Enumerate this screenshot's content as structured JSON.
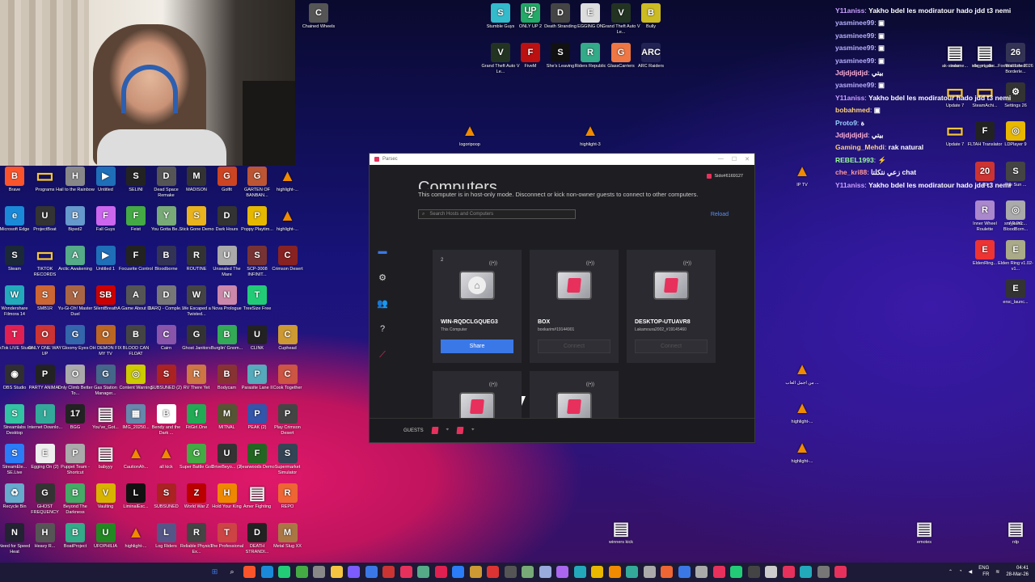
{
  "left_icons": [
    {
      "label": "Brave",
      "color": "#fb542b",
      "glyph": "B"
    },
    {
      "label": "Programs",
      "color": "#f5c542",
      "glyph": "▭"
    },
    {
      "label": "Hail to the Rainbow",
      "color": "#888",
      "glyph": "H"
    },
    {
      "label": "Untitled",
      "color": "#1e6fb8",
      "glyph": "▶"
    },
    {
      "label": "SELINI",
      "color": "#222",
      "glyph": "S"
    },
    {
      "label": "Dead Space Remake",
      "color": "#555",
      "glyph": "D"
    },
    {
      "label": "MADISON",
      "color": "#333",
      "glyph": "M"
    },
    {
      "label": "Golfit",
      "color": "#c42",
      "glyph": "G"
    },
    {
      "label": "GARTEN OF BANBAN...",
      "color": "#b53",
      "glyph": "G"
    },
    {
      "label": "highlight-...",
      "color": "#f08a00",
      "glyph": "▲"
    },
    {
      "label": "Microsoft Edge",
      "color": "#1a8ad8",
      "glyph": "e"
    },
    {
      "label": "ProjectBoat",
      "color": "#333",
      "glyph": "U"
    },
    {
      "label": "Biped2",
      "color": "#69c",
      "glyph": "B"
    },
    {
      "label": "Fall Guys",
      "color": "#c6e",
      "glyph": "F"
    },
    {
      "label": "Feist",
      "color": "#4a4",
      "glyph": "F"
    },
    {
      "label": "You Gotta Be...",
      "color": "#7a7",
      "glyph": "Y"
    },
    {
      "label": "Stick Gone Demo",
      "color": "#e8b31d",
      "glyph": "S"
    },
    {
      "label": "Dark Hours",
      "color": "#333",
      "glyph": "D"
    },
    {
      "label": "Poppy Playtim...",
      "color": "#e6b800",
      "glyph": "P"
    },
    {
      "label": "highlight-...",
      "color": "#f08a00",
      "glyph": "▲"
    },
    {
      "label": "Steam",
      "color": "#1b2838",
      "glyph": "S"
    },
    {
      "label": "TIKTOK RECORDS",
      "color": "#f5c542",
      "glyph": "▭"
    },
    {
      "label": "Arctic Awakening",
      "color": "#5a8",
      "glyph": "A"
    },
    {
      "label": "Untitled 1",
      "color": "#1e6fb8",
      "glyph": "▶"
    },
    {
      "label": "Focusrite Control",
      "color": "#222",
      "glyph": "F"
    },
    {
      "label": "Bloodborne",
      "color": "#335",
      "glyph": "B"
    },
    {
      "label": "ROUTINE",
      "color": "#333",
      "glyph": "R"
    },
    {
      "label": "Unsealed The Mare",
      "color": "#aaa",
      "glyph": "U"
    },
    {
      "label": "SCP-3008 INFINIT...",
      "color": "#733",
      "glyph": "S"
    },
    {
      "label": "Crimson Desert",
      "color": "#822",
      "glyph": "C"
    },
    {
      "label": "Wondershare Filmora 14",
      "color": "#2ab",
      "glyph": "W"
    },
    {
      "label": "SMB1R",
      "color": "#c63",
      "glyph": "S"
    },
    {
      "label": "Yu-Gi-Oh! Master Duel",
      "color": "#a64",
      "glyph": "Y"
    },
    {
      "label": "SilentBreath",
      "color": "#c00",
      "glyph": "SB"
    },
    {
      "label": "A Game About D...",
      "color": "#555",
      "glyph": "A"
    },
    {
      "label": "DARQ - Comple...",
      "color": "#777",
      "glyph": "D"
    },
    {
      "label": "We Escaped a Twisted...",
      "color": "#444",
      "glyph": "W"
    },
    {
      "label": "Nova Prologue",
      "color": "#c8a",
      "glyph": "N"
    },
    {
      "label": "TreeSize Free",
      "color": "#2c7",
      "glyph": "T"
    },
    {
      "label": "",
      "color": "transparent",
      "glyph": ""
    },
    {
      "label": "TikTok LIVE Studio",
      "color": "#e02050",
      "glyph": "T"
    },
    {
      "label": "ONLY ONE WAY UP",
      "color": "#c33",
      "glyph": "O"
    },
    {
      "label": "Gloomy Eyes",
      "color": "#36a",
      "glyph": "G"
    },
    {
      "label": "OH DEMON FIX MY TV",
      "color": "#b62",
      "glyph": "O"
    },
    {
      "label": "BLOOD CAN FLOAT",
      "color": "#444",
      "glyph": "B"
    },
    {
      "label": "Cairn",
      "color": "#85a",
      "glyph": "C"
    },
    {
      "label": "Ghost Janitors",
      "color": "#333",
      "glyph": "G"
    },
    {
      "label": "Burglin' Gnom...",
      "color": "#3a5",
      "glyph": "B"
    },
    {
      "label": "CLINK",
      "color": "#222",
      "glyph": "U"
    },
    {
      "label": "Cuphead",
      "color": "#c93",
      "glyph": "C"
    },
    {
      "label": "OBS Studio",
      "color": "#302e31",
      "glyph": "◉"
    },
    {
      "label": "PARTY ANIMAL",
      "color": "#222",
      "glyph": "P"
    },
    {
      "label": "Only Climb Better To...",
      "color": "#aaa",
      "glyph": "O"
    },
    {
      "label": "Gas Station Manager...",
      "color": "#468",
      "glyph": "G"
    },
    {
      "label": "Content Warning",
      "color": "#cc0",
      "glyph": "◎"
    },
    {
      "label": "SUBSUNED (2)",
      "color": "#a22",
      "glyph": "S"
    },
    {
      "label": "RV There Yet",
      "color": "#c74",
      "glyph": "R"
    },
    {
      "label": "Bodycam",
      "color": "#833",
      "glyph": "B"
    },
    {
      "label": "Parasite Lane II",
      "color": "#5ab",
      "glyph": "P"
    },
    {
      "label": "Cook Together",
      "color": "#c54",
      "glyph": "C"
    },
    {
      "label": "Streamlabs Desktop",
      "color": "#31c3a2",
      "glyph": "S"
    },
    {
      "label": "Internet Downlo...",
      "color": "#3a9",
      "glyph": "I"
    },
    {
      "label": "BGG",
      "color": "#222",
      "glyph": "17"
    },
    {
      "label": "You've_Got...",
      "color": "#eee",
      "glyph": "▤"
    },
    {
      "label": "IMG_20250...",
      "color": "#68a",
      "glyph": "▦"
    },
    {
      "label": "Bendy and the Dark ...",
      "color": "#fff",
      "glyph": "B"
    },
    {
      "label": "FitGirl.One",
      "color": "#2a5",
      "glyph": "f"
    },
    {
      "label": "MITNAL",
      "color": "#553",
      "glyph": "M"
    },
    {
      "label": "PEAK (2)",
      "color": "#35a",
      "glyph": "P"
    },
    {
      "label": "Play Crimson Desert",
      "color": "#444",
      "glyph": "P"
    },
    {
      "label": "StreamEle... SE.Live",
      "color": "#2a7cf7",
      "glyph": "S"
    },
    {
      "label": "Egging On (2)",
      "color": "#eee",
      "glyph": "E"
    },
    {
      "label": "Puppet Team - Shortcut",
      "color": "#aaa",
      "glyph": "P"
    },
    {
      "label": "babyyy",
      "color": "#eee",
      "glyph": "▤"
    },
    {
      "label": "CautionAh...",
      "color": "#e8a000",
      "glyph": "▲"
    },
    {
      "label": "all kick",
      "color": "#f08a00",
      "glyph": "▲"
    },
    {
      "label": "Super Battle Golf",
      "color": "#4a4",
      "glyph": "G"
    },
    {
      "label": "DriveBeyo... (2)",
      "color": "#333",
      "glyph": "U"
    },
    {
      "label": "Fearwoods Demo",
      "color": "#262",
      "glyph": "F"
    },
    {
      "label": "Supermarket Simulator",
      "color": "#345",
      "glyph": "S"
    },
    {
      "label": "Recycle Bin",
      "color": "#6ac",
      "glyph": "♻"
    },
    {
      "label": "GHOST FREQUENCY",
      "color": "#333",
      "glyph": "G"
    },
    {
      "label": "Beyond The Darkness",
      "color": "#4a6",
      "glyph": "B"
    },
    {
      "label": "Vaulting",
      "color": "#d8b400",
      "glyph": "V"
    },
    {
      "label": "LiminalExc...",
      "color": "#111",
      "glyph": "L"
    },
    {
      "label": "SUBSUNED",
      "color": "#a22",
      "glyph": "S"
    },
    {
      "label": "World War Z",
      "color": "#b00",
      "glyph": "Z"
    },
    {
      "label": "Hold Your King",
      "color": "#e80",
      "glyph": "H"
    },
    {
      "label": "Amer Fighting",
      "color": "#eee",
      "glyph": "▤"
    },
    {
      "label": "REPO",
      "color": "#e63",
      "glyph": "R"
    },
    {
      "label": "Need for Speed Heat",
      "color": "#223",
      "glyph": "N"
    },
    {
      "label": "Heavy R...",
      "color": "#555",
      "glyph": "H"
    },
    {
      "label": "BoatProject",
      "color": "#3a8",
      "glyph": "B"
    },
    {
      "label": "UFOPHILIA",
      "color": "#282",
      "glyph": "U"
    },
    {
      "label": "highlight-...",
      "color": "#f08a00",
      "glyph": "▲"
    },
    {
      "label": "Log Riders",
      "color": "#558",
      "glyph": "L"
    },
    {
      "label": "Reliable Physics Ex...",
      "color": "#444",
      "glyph": "R"
    },
    {
      "label": "The Professional",
      "color": "#c44",
      "glyph": "T"
    },
    {
      "label": "DEATH STRANDI...",
      "color": "#222",
      "glyph": "D"
    },
    {
      "label": "Metal Slug XX",
      "color": "#a74",
      "glyph": "M"
    }
  ],
  "top_icons": [
    {
      "label": "Chained Wheels",
      "color": "#555",
      "glyph": "C"
    },
    {
      "label": "Stumble Guys",
      "color": "#3bc",
      "glyph": "S"
    },
    {
      "label": "ONLY UP 2",
      "color": "#2a6",
      "glyph": "UP 2"
    },
    {
      "label": "Death Stranding",
      "color": "#444",
      "glyph": "D"
    },
    {
      "label": "EGGING ON",
      "color": "#ddd",
      "glyph": "E"
    },
    {
      "label": "Grand Theft Auto V Le...",
      "color": "#232",
      "glyph": "V"
    },
    {
      "label": "Bully",
      "color": "#cb2",
      "glyph": "B"
    },
    {
      "label": "Grand Theft Auto V Le...",
      "color": "#232",
      "glyph": "V"
    },
    {
      "label": "FiveM",
      "color": "#b11",
      "glyph": "F"
    },
    {
      "label": "She's Leaving",
      "color": "#111",
      "glyph": "S"
    },
    {
      "label": "Riders Republic",
      "color": "#3a8",
      "glyph": "R"
    },
    {
      "label": "GlassCarriers",
      "color": "#e74",
      "glyph": "G"
    },
    {
      "label": "ARC Raiders",
      "color": "#225",
      "glyph": "ARC"
    },
    {
      "label": "logoripoop",
      "color": "#f08a00",
      "glyph": "▲"
    },
    {
      "label": "highlight-3",
      "color": "#f08a00",
      "glyph": "▲"
    }
  ],
  "right_icons": [
    {
      "label": "subs",
      "color": "#eee",
      "glyph": "▤"
    },
    {
      "label": "esport_dis...",
      "color": "#eee",
      "glyph": "▤"
    },
    {
      "label": "Windowed Borderle...",
      "color": "#eee",
      "glyph": "▤"
    },
    {
      "label": "ak-streame...",
      "color": "#eee",
      "glyph": "▤"
    },
    {
      "label": "idle_master...",
      "color": "#eee",
      "glyph": "▤"
    },
    {
      "label": "Football Life 2026",
      "color": "#335",
      "glyph": "26"
    },
    {
      "label": "Update 7",
      "color": "#f5c542",
      "glyph": "▭"
    },
    {
      "label": "SteamAchi...",
      "color": "#f5c542",
      "glyph": "▭"
    },
    {
      "label": "Settings 26",
      "color": "#333",
      "glyph": "⚙"
    },
    {
      "label": "Update 7",
      "color": "#f5c542",
      "glyph": "▭"
    },
    {
      "label": "FLTAH Translator",
      "color": "#222",
      "glyph": "F"
    },
    {
      "label": "LDPlayer 9",
      "color": "#e8b800",
      "glyph": "◎"
    },
    {
      "label": "IP TV",
      "color": "#f08a00",
      "glyph": "▲"
    },
    {
      "label": "20",
      "color": "#c33",
      "glyph": "20"
    },
    {
      "label": "The Sun ...",
      "color": "#444",
      "glyph": "S"
    },
    {
      "label": "Inner Wheel Roulette",
      "color": "#a8c",
      "glyph": "R"
    },
    {
      "label": "AR PC BloodBorn...",
      "color": "#eee",
      "glyph": "▤"
    },
    {
      "label": "sm_launc...",
      "color": "#aaa",
      "glyph": "◎"
    },
    {
      "label": "EldenRing...",
      "color": "#e33",
      "glyph": "E"
    },
    {
      "label": "Elden Ring v1.02-v1...",
      "color": "#aa8",
      "glyph": "E"
    },
    {
      "label": "ersc_launc...",
      "color": "#333",
      "glyph": "E"
    },
    {
      "label": "من أجمل ألعاب ...",
      "color": "#f08a00",
      "glyph": "▲"
    },
    {
      "label": "highlight-...",
      "color": "#f08a00",
      "glyph": "▲"
    },
    {
      "label": "highlight-...",
      "color": "#f08a00",
      "glyph": "▲"
    },
    {
      "label": "winners kick",
      "color": "#eee",
      "glyph": "▤"
    },
    {
      "label": "emotes",
      "color": "#eee",
      "glyph": "▤"
    },
    {
      "label": "rdp",
      "color": "#eee",
      "glyph": "▤"
    }
  ],
  "chat": [
    {
      "name": "Y11aniss",
      "color": "#c9a0ff",
      "msg": "Yakho bdel les modiratour hado jdd t3 nemi"
    },
    {
      "name": "yasminee99",
      "color": "#b9b0ff",
      "msg": "▣"
    },
    {
      "name": "yasminee99",
      "color": "#b9b0ff",
      "msg": "▣"
    },
    {
      "name": "yasminee99",
      "color": "#b9b0ff",
      "msg": "▣"
    },
    {
      "name": "yasminee99",
      "color": "#b9b0ff",
      "msg": "▣"
    },
    {
      "name": "Jdjdjdjdjd",
      "color": "#ffb3d9",
      "msg": "بيتي"
    },
    {
      "name": "yasminee99",
      "color": "#b9b0ff",
      "msg": "▣"
    },
    {
      "name": "Y11aniss",
      "color": "#c9a0ff",
      "msg": "Yakho bdel les modiratour hado jdd t3 nemi"
    },
    {
      "name": "bobahmed",
      "color": "#ffd27a",
      "msg": "▣"
    },
    {
      "name": "Proto9",
      "color": "#9ad0ff",
      "msg": "ة"
    },
    {
      "name": "Jdjdjdjdjd",
      "color": "#ffb3d9",
      "msg": "بيتي"
    },
    {
      "name": "Gaming_Mehdi",
      "color": "#ffd27a",
      "msg": "rak natural"
    },
    {
      "name": "REBEL1993",
      "color": "#9aff9a",
      "msg": "⚡"
    },
    {
      "name": "che_kri88",
      "color": "#ff9a9a",
      "msg": "زعي نتكلتا chat"
    },
    {
      "name": "Y11aniss",
      "color": "#c9a0ff",
      "msg": "Yakho bdel les modiratour hado jdd t3 nemi"
    }
  ],
  "parsec": {
    "window_title": "Parsec",
    "heading": "Computers",
    "host_note": "This computer is in host-only mode. Disconnect or kick non-owner guests to connect to other computers.",
    "user": "Sido#6169127",
    "search_placeholder": "Search Hosts and Computers",
    "reload": "Reload",
    "cards": [
      {
        "badge": "2",
        "name": "WIN-RQDCLGQUEG3",
        "sub": "This Computer",
        "button": "Share",
        "type": "host"
      },
      {
        "badge": "",
        "name": "BOX",
        "sub": "boxkarim#19144901",
        "button": "Connect",
        "type": "remote"
      },
      {
        "badge": "",
        "name": "DESKTOP-UTUAVR8",
        "sub": "Lakamoura2002_#19145460",
        "button": "Connect",
        "type": "remote"
      },
      {
        "badge": "",
        "name": "",
        "sub": "",
        "button": "",
        "type": "remote"
      },
      {
        "badge": "",
        "name": "",
        "sub": "",
        "button": "",
        "type": "remote"
      }
    ],
    "guests_label": "GUESTS"
  },
  "taskbar": {
    "lang_top": "ENG",
    "lang_bottom": "FR",
    "time": "04:41",
    "date": "28-Mar-26"
  }
}
